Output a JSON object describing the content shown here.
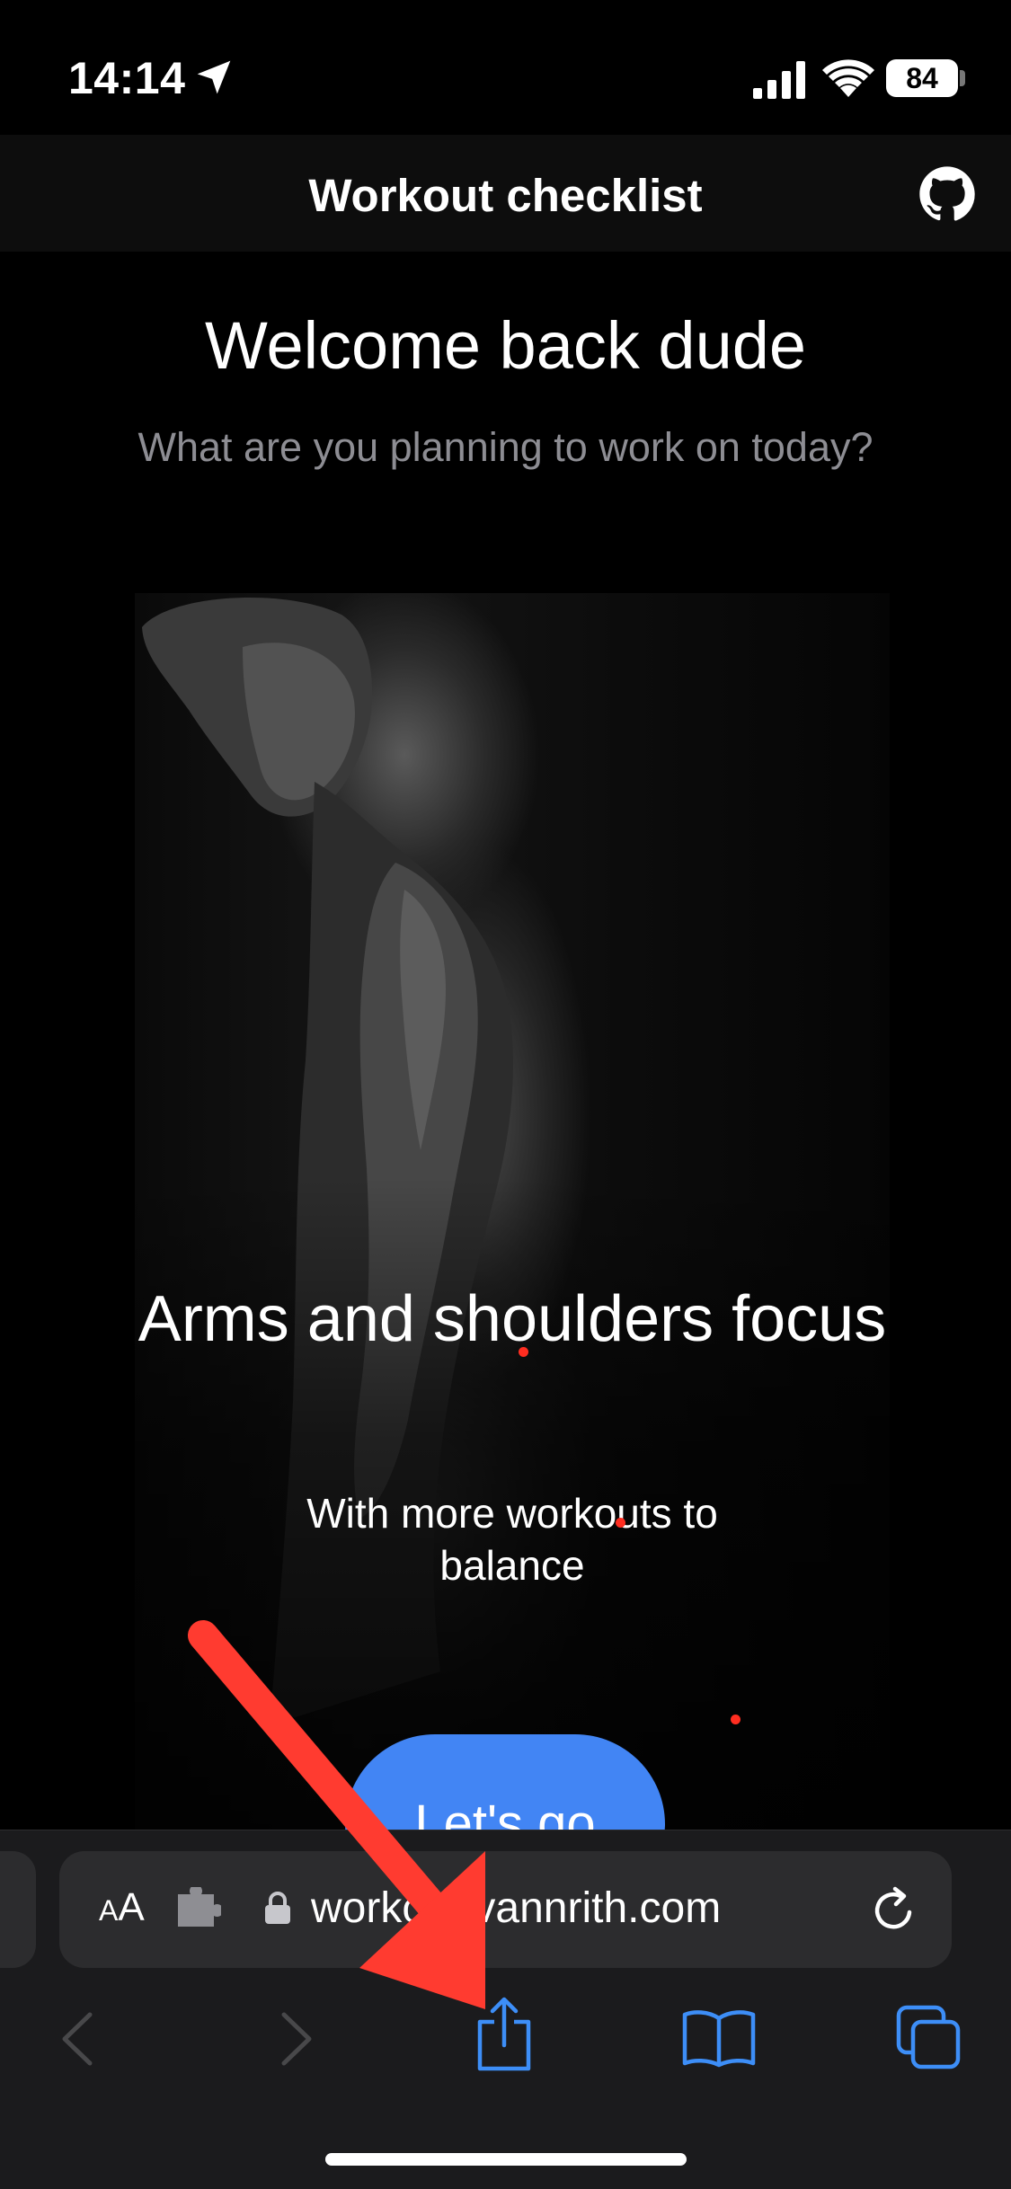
{
  "status_bar": {
    "time": "14:14",
    "battery": "84"
  },
  "header": {
    "title": "Workout checklist"
  },
  "hero": {
    "title": "Welcome back dude",
    "subtitle": "What are you planning to work on today?"
  },
  "card": {
    "title": "Arms and shoulders focus",
    "subtitle": "With more workouts to balance",
    "cta_label": "Let's go"
  },
  "browser": {
    "reader_label": "AA",
    "url": "workout.vannrith.com"
  },
  "colors": {
    "accent": "#4285f4",
    "toolbar_icon": "#3d8ef7",
    "annotation": "#ff3b30"
  },
  "icons": {
    "location": "location-arrow-icon",
    "signal": "signal-icon",
    "wifi": "wifi-icon",
    "github": "github-icon",
    "extension": "puzzle-icon",
    "lock": "lock-icon",
    "reload": "reload-icon",
    "back": "chevron-left-icon",
    "forward": "chevron-right-icon",
    "share": "share-icon",
    "bookmarks": "book-icon",
    "tabs": "tabs-icon"
  }
}
